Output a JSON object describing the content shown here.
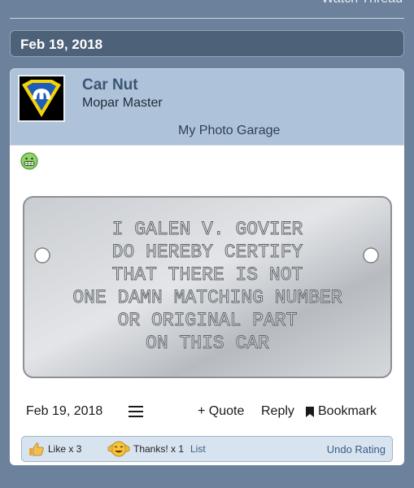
{
  "header": {
    "watch_thread": "Watch Thread",
    "date": "Feb 19, 2018"
  },
  "user": {
    "name": "Car Nut",
    "title": "Mopar Master",
    "garage_link": "My Photo Garage",
    "avatar": "mopar-m-superman-logo"
  },
  "post": {
    "smiley": "grinning-smiley",
    "image_alt": "Stamped metal tag",
    "plate_lines": [
      "I GALEN V. GOVIER",
      "DO HEREBY CERTIFY",
      "THAT THERE IS NOT",
      "ONE DAMN MATCHING NUMBER",
      "OR ORIGINAL PART",
      "ON THIS CAR"
    ]
  },
  "footer": {
    "date": "Feb 19, 2018",
    "quote": "+ Quote",
    "reply": "Reply",
    "bookmark": "Bookmark"
  },
  "ratings": {
    "like": "Like x 3",
    "thanks": "Thanks! x 1",
    "list": "List",
    "undo": "Undo Rating"
  },
  "colors": {
    "background": "#6c819b",
    "date_bar": "#4d6178",
    "user_card": "#aec3da",
    "username": "#3b5573"
  }
}
